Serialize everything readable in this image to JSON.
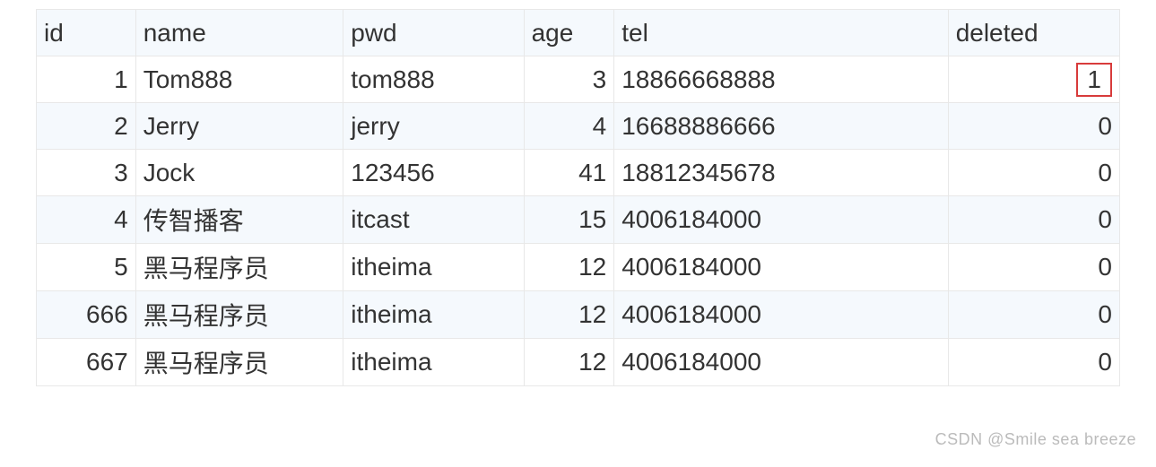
{
  "table": {
    "headers": {
      "id": "id",
      "name": "name",
      "pwd": "pwd",
      "age": "age",
      "tel": "tel",
      "deleted": "deleted"
    },
    "rows": [
      {
        "id": "1",
        "name": "Tom888",
        "pwd": "tom888",
        "age": "3",
        "tel": "18866668888",
        "deleted": "1",
        "highlight": true
      },
      {
        "id": "2",
        "name": "Jerry",
        "pwd": "jerry",
        "age": "4",
        "tel": "16688886666",
        "deleted": "0",
        "highlight": false
      },
      {
        "id": "3",
        "name": "Jock",
        "pwd": "123456",
        "age": "41",
        "tel": "18812345678",
        "deleted": "0",
        "highlight": false
      },
      {
        "id": "4",
        "name": "传智播客",
        "pwd": "itcast",
        "age": "15",
        "tel": "4006184000",
        "deleted": "0",
        "highlight": false
      },
      {
        "id": "5",
        "name": "黑马程序员",
        "pwd": "itheima",
        "age": "12",
        "tel": "4006184000",
        "deleted": "0",
        "highlight": false
      },
      {
        "id": "666",
        "name": "黑马程序员",
        "pwd": "itheima",
        "age": "12",
        "tel": "4006184000",
        "deleted": "0",
        "highlight": false
      },
      {
        "id": "667",
        "name": "黑马程序员",
        "pwd": "itheima",
        "age": "12",
        "tel": "4006184000",
        "deleted": "0",
        "highlight": false
      }
    ]
  },
  "watermark": "CSDN @Smile sea breeze"
}
